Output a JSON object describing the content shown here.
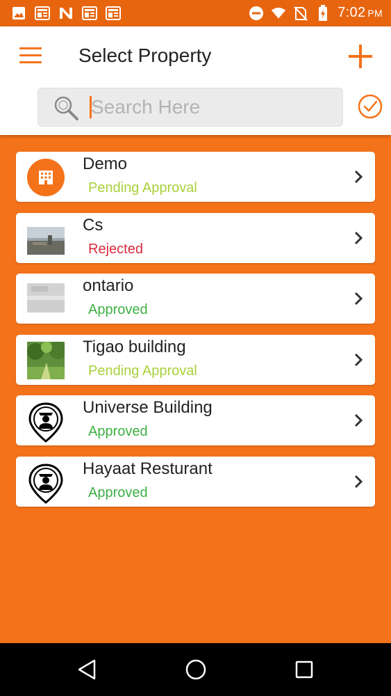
{
  "status_bar": {
    "time": "7:02",
    "ampm": "PM",
    "left_icons": [
      "image-icon",
      "news-icon",
      "n-logo-icon",
      "news-icon",
      "news-icon"
    ],
    "right_icons": [
      "do-not-disturb-icon",
      "wifi-icon",
      "no-sim-icon",
      "battery-charging-icon"
    ]
  },
  "header": {
    "title": "Select Property",
    "menu_icon": "hamburger-menu-icon",
    "add_icon": "plus-icon"
  },
  "search": {
    "placeholder": "Search Here",
    "value": "",
    "confirm_icon": "check-circle-icon"
  },
  "colors": {
    "accent": "#f4721a",
    "pending": "#a8d13a",
    "rejected": "#d92b3a",
    "approved": "#3cb043"
  },
  "properties": [
    {
      "name": "Demo",
      "status": "Pending Approval",
      "thumbnail": "building-icon"
    },
    {
      "name": "Cs",
      "status": "Rejected",
      "thumbnail": "photo"
    },
    {
      "name": "ontario",
      "status": "Approved",
      "thumbnail": "photo"
    },
    {
      "name": "Tigao building",
      "status": "Pending Approval",
      "thumbnail": "photo"
    },
    {
      "name": "Universe Building",
      "status": "Approved",
      "thumbnail": "guard-pin-icon"
    },
    {
      "name": "Hayaat Resturant",
      "status": "Approved",
      "thumbnail": "guard-pin-icon"
    }
  ],
  "nav": {
    "back_icon": "back-triangle-icon",
    "home_icon": "home-circle-icon",
    "recents_icon": "recents-square-icon"
  }
}
